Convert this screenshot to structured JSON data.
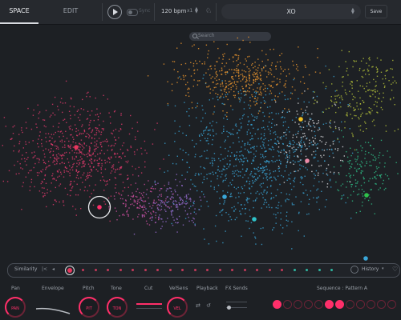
{
  "tabs": [
    {
      "label": "SPACE",
      "active": true
    },
    {
      "label": "EDIT",
      "active": false
    }
  ],
  "transport": {
    "play_icon": "play-icon",
    "sync_label": "Sync",
    "tempo": "120 bpm",
    "multiplier": "x1"
  },
  "kit": {
    "name": "XO",
    "save_label": "Save"
  },
  "search": {
    "placeholder": "Search"
  },
  "similarity": {
    "label": "Similarity",
    "prev": "|<",
    "back": "◂",
    "history_label": "History",
    "history_arrow": "▾"
  },
  "params": {
    "labels": [
      "Pan",
      "Envelope",
      "Pitch",
      "Tone",
      "Cut",
      "VelSens",
      "Playback",
      "FX Sends",
      "Sequence : Pattern A"
    ],
    "knobs": [
      "PAN",
      "PIT",
      "TON",
      "VEL"
    ]
  },
  "colors": {
    "accent": "#ff2f6a",
    "background": "#1d2024",
    "topbar": "#26292e"
  },
  "map_clusters": [
    {
      "color": "#e23a6d",
      "count": 700
    },
    {
      "color": "#cf4fa0",
      "count": 140
    },
    {
      "color": "#3aa6d8",
      "count": 900
    },
    {
      "color": "#f29a2e",
      "count": 420
    },
    {
      "color": "#b8c53a",
      "count": 220
    },
    {
      "color": "#2fc28a",
      "count": 160
    },
    {
      "color": "#9b6fd6",
      "count": 160
    },
    {
      "color": "#e7e7ea",
      "count": 140
    }
  ]
}
